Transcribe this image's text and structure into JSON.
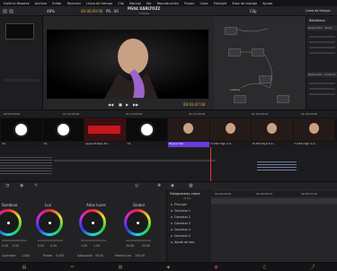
{
  "menu": [
    "DaVinci Resolve",
    "Archivo",
    "Editar",
    "Recortar",
    "Línea de tiempo",
    "Clip",
    "Marcas",
    "Ver",
    "Reproducción",
    "Fusion",
    "Color",
    "Fairlight",
    "Área de trabajo",
    "Ayuda"
  ],
  "toolbar": {
    "zoom": "48%",
    "timecode_left": "00:00:00:00",
    "clip_name": "P0...00",
    "title": "PG04 XARLTOZZ",
    "edited": "Editado",
    "clip_label": "Clip",
    "lib_label": "Línea de tiempo"
  },
  "viewer": {
    "timecode": "00:03:47:04"
  },
  "library": {
    "title": "Biblioteca",
    "fx_label": "ResolveFX - Temp",
    "fx2_label": "ResolveFX - Imitació"
  },
  "node_area": {
    "nodes": [
      "01",
      "02",
      "03",
      "04",
      "05",
      "06",
      "Lumina"
    ]
  },
  "timeline_bar": {
    "tc": [
      "00:00:00:00",
      "01:04:00:00",
      "01:10:00:00",
      "01:21:05:00",
      "01:25:00:10",
      "01:28:30:00"
    ]
  },
  "thumb_labels": [
    "12",
    "V1",
    "Apple ProRes 44...",
    "V1",
    "Nuevo Clip",
    "H.264 High 4:2...",
    "H.264 High 4:2...",
    "H.264 High 4:2..."
  ],
  "color_wheels": [
    {
      "label": "Lift",
      "values": [
        "0.00",
        "0.00",
        "0.00",
        "0.00"
      ]
    },
    {
      "label": "Gamma",
      "values": [
        "0.00",
        "0.00",
        "0.00",
        "0.00"
      ]
    },
    {
      "label": "Gain",
      "values": [
        "1.00",
        "1.00",
        "1.00",
        "1.00"
      ]
    },
    {
      "label": "Offset",
      "values": [
        "25.00",
        "25.00",
        "25.00",
        "25.00"
      ]
    }
  ],
  "wheel_titles": [
    "Sombras",
    "Luz",
    "Altas luces",
    "Global"
  ],
  "bottom_params": {
    "contrast": "Contraste",
    "contrast_val": "1.000",
    "pivot": "Pivote",
    "pivot_val": "0.435",
    "sat": "Saturación",
    "sat_val": "50.00",
    "lum": "Mezcla lum.",
    "lum_val": "100.00"
  },
  "layers": {
    "title": "Fotogramas clave",
    "all": "Todos",
    "items": [
      "Principal",
      "Corrector 1",
      "Corrector 2",
      "Corrector 3",
      "Corrector 4",
      "Corrector 5",
      "Ajuste de tam."
    ]
  },
  "keyframe_header": [
    "00:00:00:00",
    "00:00:00:15",
    "00:00:01:05"
  ],
  "pages": [
    "media-icon",
    "cut-icon",
    "edit-icon",
    "fusion-icon",
    "color-icon",
    "fairlight-icon",
    "deliver-icon"
  ],
  "colors": {
    "accent": "#6a3bd9",
    "timecode": "#d8b24a"
  }
}
